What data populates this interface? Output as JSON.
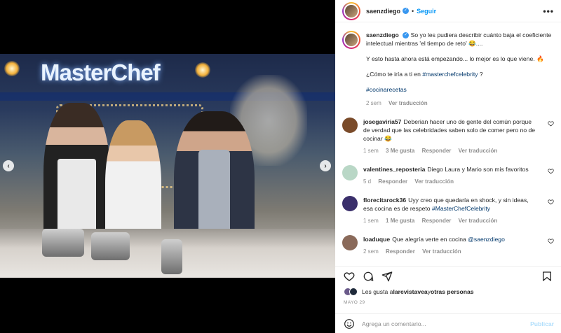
{
  "post": {
    "media": {
      "logo_text": "MasterChef",
      "nav_prev": "‹",
      "nav_next": "›"
    }
  },
  "header": {
    "username": "saenzdiego",
    "separator": "•",
    "follow_label": "Seguir",
    "more_icon": "more-horizontal-icon",
    "more_glyph": "•••"
  },
  "caption": {
    "username": "saenzdiego",
    "line1": "So yo les pudiera describir cuánto baja el coeficiente intelectual mientras 'el tiempo de reto' 😂....",
    "line2": "Y esto hasta ahora está empezando... lo mejor es lo que viene. 🔥",
    "line3_text": "¿Cómo te iría a ti en ",
    "line3_tag": "#masterchefcelebrity",
    "line3_end": " ?",
    "hashtag": "#cocinarecetas",
    "time": "2 sem",
    "translate": "Ver traducción"
  },
  "comments": [
    {
      "username": "josegaviria57",
      "text": "Deberian hacer uno de gente del común porque de verdad que las celebridades saben solo de comer pero no de cocinar 😂",
      "time": "1 sem",
      "likes": "3 Me gusta",
      "reply": "Responder",
      "translate": "Ver traducción",
      "avatar_color": "#7a4b2a"
    },
    {
      "username": "valentines_reposteria",
      "text": "Diego Laura y Mario son mis favoritos",
      "time": "5 d",
      "reply": "Responder",
      "translate": "Ver traducción",
      "avatar_color": "#b9d7c6"
    },
    {
      "username": "florecitarock36",
      "text_before": "Uyy creo que quedaría en shock, y sin ideas, esa cocina es de respeto ",
      "text_tag": "#MasterChefCelebrity",
      "time": "1 sem",
      "likes": "1 Me gusta",
      "reply": "Responder",
      "translate": "Ver traducción",
      "avatar_color": "#3a2f6b"
    },
    {
      "username": "loaduque",
      "text_before": "Que alegría verte en cocina ",
      "text_mention": "@saenzdiego",
      "time": "2 sem",
      "reply": "Responder",
      "translate": "Ver traducción",
      "avatar_color": "#8a6a5a"
    }
  ],
  "likes": {
    "prefix": "Les gusta a ",
    "user": "larevistavea",
    "connector": " y ",
    "others": "otras personas"
  },
  "date": "MAYO 29",
  "composer": {
    "placeholder": "Agrega un comentario...",
    "post_label": "Publicar"
  },
  "colors": {
    "accent": "#0095f6",
    "verified": "#3897f0",
    "link": "#00376b",
    "muted": "#8e8e8e"
  }
}
